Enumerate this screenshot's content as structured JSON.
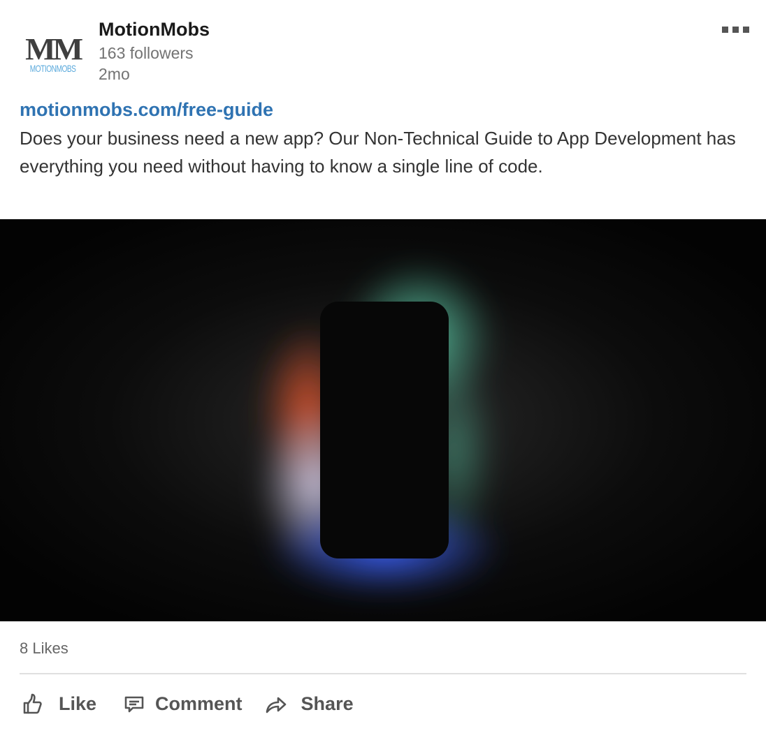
{
  "header": {
    "logo_mark": "MM",
    "logo_word": "MOTIONMOBS",
    "company_name": "MotionMobs",
    "followers": "163 followers",
    "time": "2mo"
  },
  "post": {
    "link": "motionmobs.com/free-guide",
    "caption": "Does your business need a new app? Our Non-Technical Guide to App Development has everything you need without having to know a single line of code."
  },
  "footer": {
    "likes": "8 Likes",
    "actions": {
      "like": "Like",
      "comment": "Comment",
      "share": "Share"
    }
  },
  "icons": {
    "more": "ellipsis-icon",
    "like": "thumbs-up-icon",
    "comment": "comment-icon",
    "share": "share-arrow-icon"
  },
  "colors": {
    "link": "#2f73b2",
    "logo_dark": "#3f3f3f",
    "logo_blue": "#5aa9dc",
    "muted_text": "#737373",
    "action_text": "#555555"
  }
}
